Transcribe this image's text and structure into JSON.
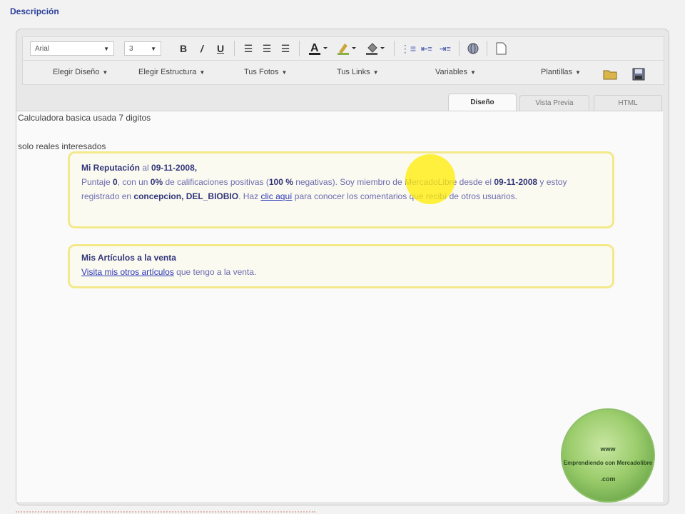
{
  "header": {
    "title": "Descripción"
  },
  "toolbar": {
    "font_family": "Arial",
    "font_size": "3",
    "bold": "B",
    "italic": "/",
    "underline": "U",
    "menus": [
      {
        "label": "Elegir Diseño"
      },
      {
        "label": "Elegir Estructura"
      },
      {
        "label": "Tus Fotos"
      },
      {
        "label": "Tus Links"
      },
      {
        "label": "Variables"
      },
      {
        "label": "Plantillas"
      }
    ]
  },
  "tabs": [
    {
      "label": "Diseño",
      "active": true
    },
    {
      "label": "Vista Previa",
      "active": false
    },
    {
      "label": "HTML",
      "active": false
    }
  ],
  "content": {
    "line1": "Calculadora basica usada 7 digitos",
    "line2": "solo reales interesados",
    "reputation": {
      "title": "Mi Reputación",
      "title_mid": " al ",
      "date": "09-11-2008",
      "title_end": ",",
      "t1": "Puntaje ",
      "score": "0",
      "t2": ", con un ",
      "pct": "0%",
      "t3": " de calificaciones positivas (",
      "neg": "100 %",
      "t4": " negativas). Soy miembro de MercadoLibre desde el ",
      "since": "09-11-2008",
      "t5": " y estoy registrado en ",
      "location": "concepcion, DEL_BIOBIO",
      "t6": ". Haz ",
      "link": "clic aquí",
      "t7": " para conocer los comentarios que recibí de otros usuarios."
    },
    "articles": {
      "title": "Mis Artículos a la venta",
      "link": "Visita mis otros artículos",
      "rest": " que tengo a la venta."
    }
  },
  "watermark": {
    "line1": "www",
    "line2": "Emprendiendo con Mercadolibre",
    "line3": ".com"
  },
  "colors": {
    "accent": "#2b3f9a",
    "box_border": "#f3e98a",
    "cursor": "#ffec00"
  }
}
